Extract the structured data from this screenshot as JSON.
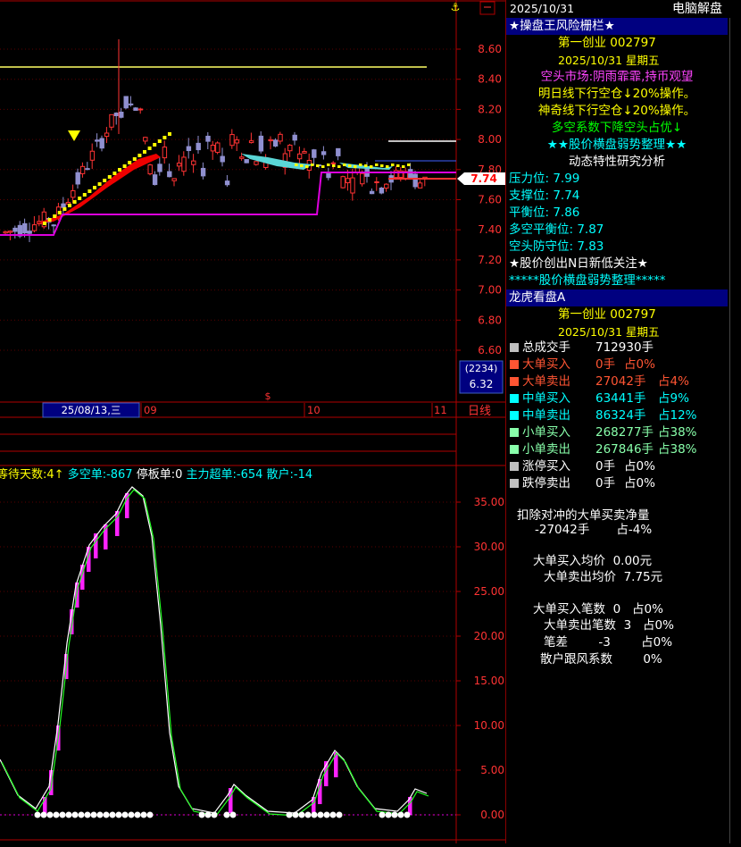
{
  "top": {
    "date": "2025/10/31",
    "right_title": "电脑解盘"
  },
  "price_axis": {
    "labels": [
      "8.60",
      "8.40",
      "8.20",
      "8.00",
      "7.80",
      "7.60",
      "7.40",
      "7.20",
      "7.00",
      "6.80",
      "6.60"
    ],
    "current": "7.74",
    "min": 6.6,
    "max": 8.6,
    "box_top": "(2234)",
    "box_bottom": "6.32"
  },
  "date_axis": {
    "cursor_date": "25/08/13,三",
    "m9": "09",
    "m10": "10",
    "m11": "11",
    "period": "日线",
    "marker": "$"
  },
  "indicator": {
    "title_parts": [
      {
        "text": "等待天数:4",
        "color": "#ffff00"
      },
      {
        "text": "↑",
        "color": "#ffff00"
      },
      {
        "text": " 多空单:-867",
        "color": "#00ffff"
      },
      {
        "text": " 停板单:0",
        "color": "#ffffff"
      },
      {
        "text": " 主力超单:-654",
        "color": "#00ffff"
      },
      {
        "text": " 散户:-14",
        "color": "#00ffff"
      }
    ],
    "labels": [
      "35.00",
      "30.00",
      "25.00",
      "20.00",
      "15.00",
      "10.00",
      "5.00",
      "0.00"
    ]
  },
  "panel1": {
    "title": "★操盘王风险栅栏★",
    "stock": "第一创业   002797",
    "date": "2025/10/31     星期五",
    "lines": [
      {
        "text": "空头市场:阴雨霏霏,持币观望",
        "color": "#ff44ff"
      },
      {
        "text": "明日线下行空仓↓20%操作。",
        "color": "#ffff00"
      },
      {
        "text": "神奇线下行空仓↓20%操作。",
        "color": "#ffff00"
      },
      {
        "text": "多空系数下降空头占优↓",
        "color": "#00ff00"
      },
      {
        "text": "★★股价横盘弱势整理★★",
        "color": "#00ffff"
      },
      {
        "text": "动态特性研究分析",
        "color": "#ffffff"
      },
      {
        "text": "压力位: 7.99",
        "color": "#00ffff"
      },
      {
        "text": "支撑位: 7.74",
        "color": "#00ffff"
      },
      {
        "text": "平衡位: 7.86",
        "color": "#00ffff"
      },
      {
        "text": "多空平衡位: 7.87",
        "color": "#00ffff"
      },
      {
        "text": "空头防守位: 7.83",
        "color": "#00ffff"
      },
      {
        "text": "★股价创出N日新低关注★",
        "color": "#ffffff"
      },
      {
        "text": "*****股价横盘弱势整理*****",
        "color": "#00ffff"
      }
    ]
  },
  "panel2": {
    "title": "龙虎看盘A",
    "stock": "第一创业   002797",
    "date": "2025/10/31     星期五",
    "rows": [
      {
        "label": "总成交手",
        "value": "712930手",
        "pct": "",
        "ind": "#c0c0c0",
        "color": "#ffffff"
      },
      {
        "label": "大单买入",
        "value": "0手",
        "pct": "占0%",
        "ind": "#ff5533",
        "color": "#ff5533"
      },
      {
        "label": "大单卖出",
        "value": "27042手",
        "pct": "占4%",
        "ind": "#ff5533",
        "color": "#ff5533"
      },
      {
        "label": "中单买入",
        "value": "63441手",
        "pct": "占9%",
        "ind": "#00ffff",
        "color": "#00ffff"
      },
      {
        "label": "中单卖出",
        "value": "86324手",
        "pct": "占12%",
        "ind": "#00ffff",
        "color": "#00ffff"
      },
      {
        "label": "小单买入",
        "value": "268277手",
        "pct": "占38%",
        "ind": "#88ffaa",
        "color": "#88ffaa"
      },
      {
        "label": "小单卖出",
        "value": "267846手",
        "pct": "占38%",
        "ind": "#88ffaa",
        "color": "#88ffaa"
      },
      {
        "label": "涨停买入",
        "value": "0手",
        "pct": "占0%",
        "ind": "#c0c0c0",
        "color": "#ffffff"
      },
      {
        "label": "跌停卖出",
        "value": "0手",
        "pct": "占0%",
        "ind": "#c0c0c0",
        "color": "#ffffff"
      }
    ],
    "net_title": "扣除对冲的大单买卖净量",
    "net_value": "-27042手       占-4%",
    "buy_avg": "大单买入均价  0.00元",
    "sell_avg": "大单卖出均价  7.75元",
    "buy_cnt": "大单买入笔数  0   占0%",
    "sell_cnt": "大单卖出笔数  3   占0%",
    "diff": "笔差        -3        占0%",
    "retail": "散户跟风系数        0%"
  }
}
